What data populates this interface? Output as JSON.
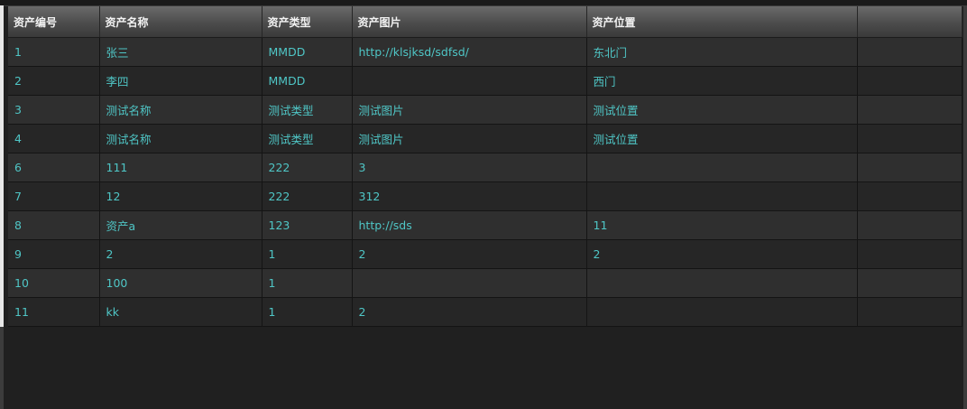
{
  "table": {
    "columns": [
      "资产编号",
      "资产名称",
      "资产类型",
      "资产图片",
      "资产位置",
      ""
    ],
    "rows": [
      [
        "1",
        "张三",
        "MMDD",
        "http://klsjksd/sdfsd/",
        "东北门",
        ""
      ],
      [
        "2",
        "李四",
        "MMDD",
        "",
        "西门",
        ""
      ],
      [
        "3",
        "测试名称",
        "测试类型",
        "测试图片",
        "测试位置",
        ""
      ],
      [
        "4",
        "测试名称",
        "测试类型",
        "测试图片",
        "测试位置",
        ""
      ],
      [
        "6",
        "111",
        "222",
        "3",
        "",
        ""
      ],
      [
        "7",
        "12",
        "222",
        "312",
        "",
        ""
      ],
      [
        "8",
        "资产a",
        "123",
        "http://sds",
        "11",
        ""
      ],
      [
        "9",
        "2",
        "1",
        "2",
        "2",
        ""
      ],
      [
        "10",
        "100",
        "1",
        "",
        "",
        ""
      ],
      [
        "11",
        "kk",
        "1",
        "2",
        "",
        ""
      ]
    ]
  },
  "colors": {
    "cell_text": "#4fc6c6",
    "header_text": "#f2f2f2",
    "row_odd": "#2f2f2f",
    "row_even": "#262626",
    "background": "#202020"
  }
}
